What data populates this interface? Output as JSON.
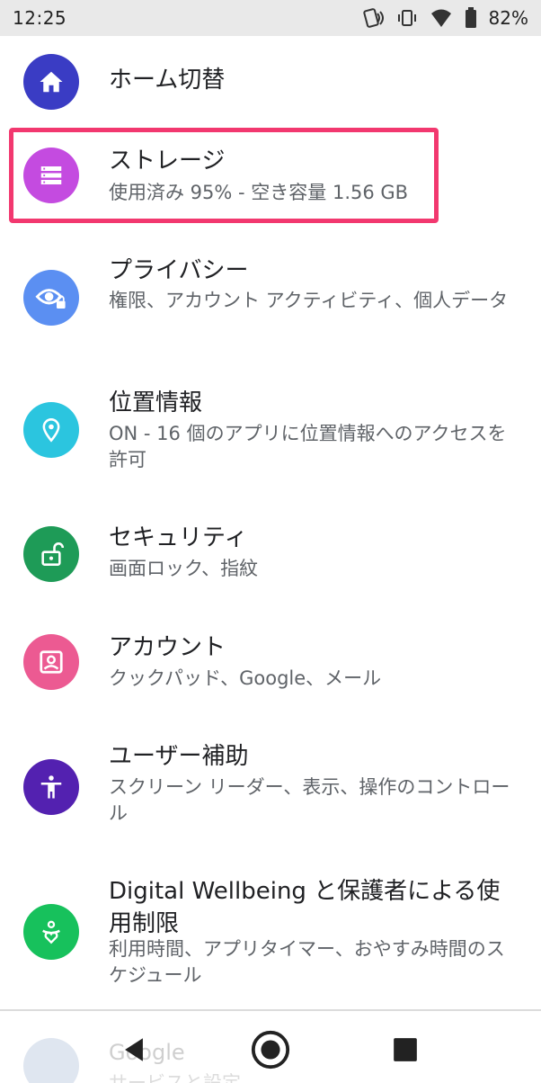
{
  "status_bar": {
    "time": "12:25",
    "battery": "82%",
    "icons": [
      "nfc-icon",
      "vibrate-icon",
      "wifi-icon",
      "battery-icon"
    ]
  },
  "settings": [
    {
      "title": "ホーム切替",
      "summary": "",
      "icon": "home-icon",
      "color": "#3a3cc4"
    },
    {
      "title": "ストレージ",
      "summary": "使用済み 95% - 空き容量 1.56 GB",
      "icon": "storage-icon",
      "color": "#c44be0"
    },
    {
      "title": "プライバシー",
      "summary": "権限、アカウント アクティビティ、個人データ",
      "icon": "privacy-icon",
      "color": "#5b8ff2"
    },
    {
      "title": "位置情報",
      "summary": "ON - 16 個のアプリに位置情報へのアクセスを許可",
      "icon": "location-icon",
      "color": "#2bc5df"
    },
    {
      "title": "セキュリティ",
      "summary": "画面ロック、指紋",
      "icon": "lock-icon",
      "color": "#1e9b57"
    },
    {
      "title": "アカウント",
      "summary": "クックパッド、Google、メール",
      "icon": "account-icon",
      "color": "#ec5a92"
    },
    {
      "title": "ユーザー補助",
      "summary": "スクリーン リーダー、表示、操作のコントロール",
      "icon": "accessibility-icon",
      "color": "#5321b0"
    },
    {
      "title": "Digital Wellbeing と保護者による使用制限",
      "summary": "利用時間、アプリタイマー、おやすみ時間のスケジュール",
      "icon": "wellbeing-icon",
      "color": "#17c15c"
    },
    {
      "title": "Google",
      "summary": "サービスと設定",
      "icon": "google-icon",
      "color": "#dfe6f0"
    }
  ],
  "navigation": [
    "back-icon",
    "home-icon",
    "recents-icon"
  ],
  "colors": {
    "highlight": "#f2386f",
    "status_bar_bg": "#e9e9e9"
  }
}
